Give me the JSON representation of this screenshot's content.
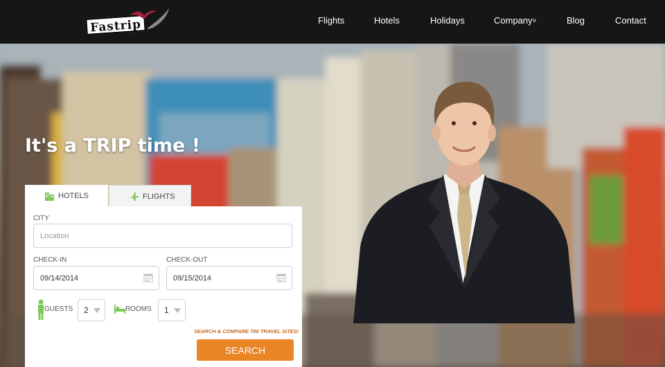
{
  "brand": {
    "name": "Fastrip",
    "accent": "#e98525",
    "icon_green": "#7ec85a"
  },
  "nav": {
    "items": [
      {
        "label": "Flights"
      },
      {
        "label": "Hotels"
      },
      {
        "label": "Holidays"
      },
      {
        "label": "Company"
      },
      {
        "label": "Blog"
      },
      {
        "label": "Contact"
      }
    ],
    "company_caret": "˅"
  },
  "hero": {
    "title": "It's a TRIP time !"
  },
  "booking": {
    "tabs": [
      {
        "label": "HOTELS",
        "icon": "building-icon",
        "active": true
      },
      {
        "label": "FLIGHTS",
        "icon": "plane-icon",
        "active": false
      }
    ],
    "city": {
      "label": "CITY",
      "placeholder": "Location",
      "value": ""
    },
    "checkin": {
      "label": "CHECK-IN",
      "value": "09/14/2014",
      "icon": "calendar-icon"
    },
    "checkout": {
      "label": "CHECK-OUT",
      "value": "09/15/2014",
      "icon": "calendar-icon"
    },
    "guests": {
      "label": "GUESTS",
      "value": "2",
      "icon": "person-icon"
    },
    "rooms": {
      "label": "ROOMS",
      "value": "1",
      "icon": "bed-icon"
    },
    "promo": "SEARCH & COMPARE 700 TRAVEL SITES!",
    "search_label": "SEARCH"
  }
}
